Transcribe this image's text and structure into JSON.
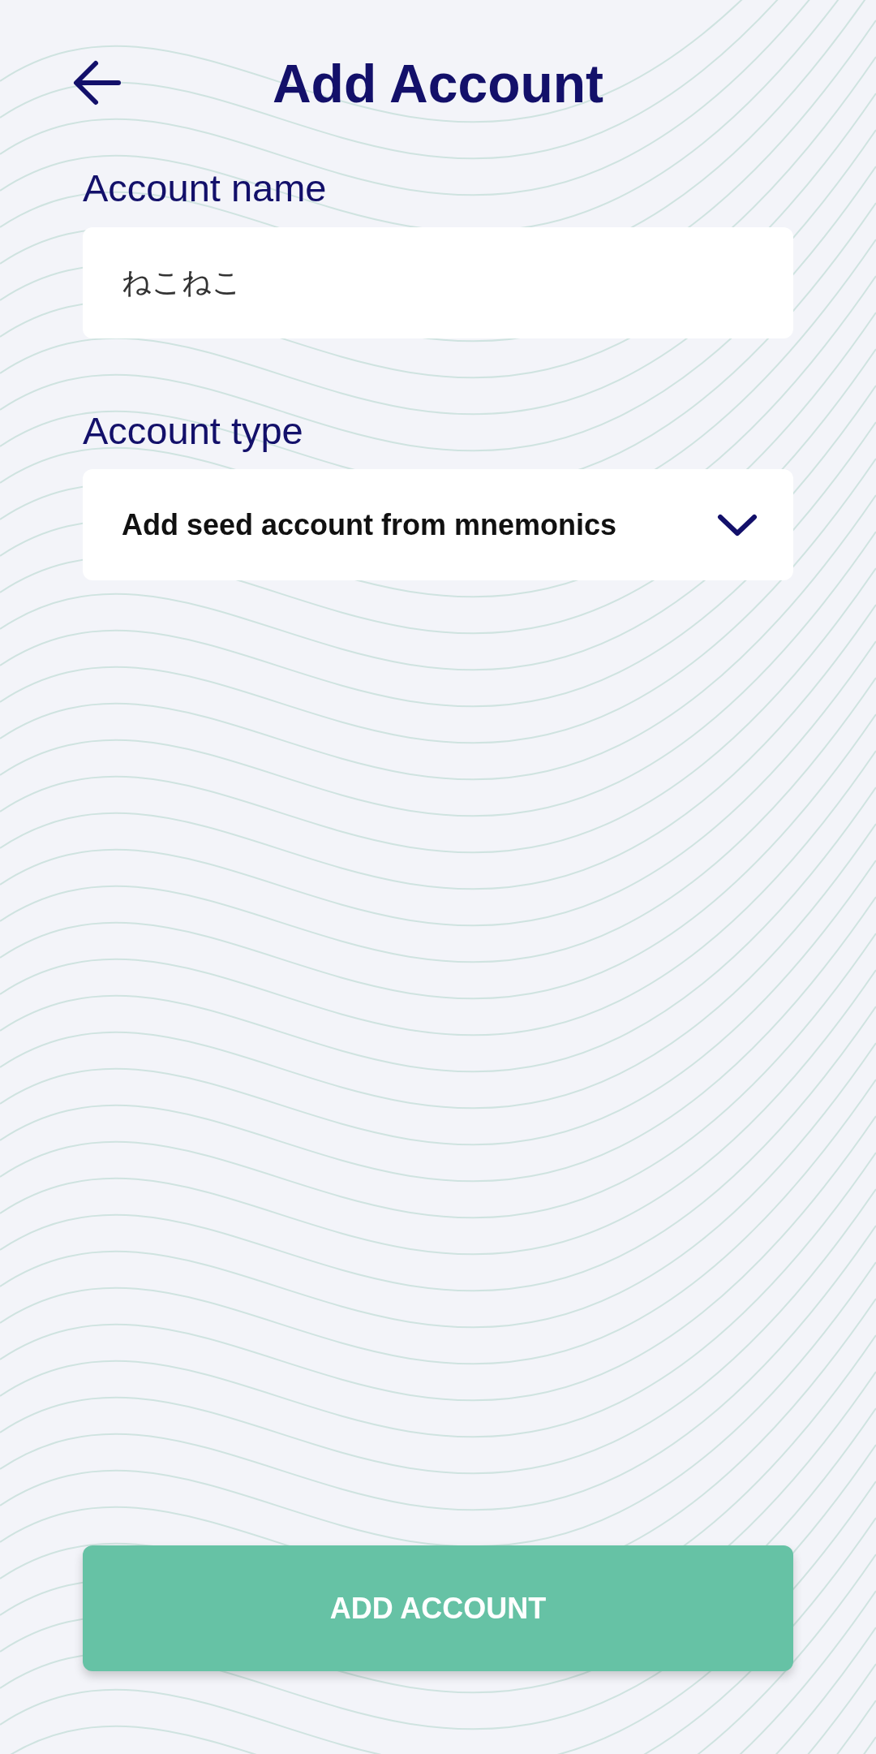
{
  "title": "Add Account",
  "fields": [
    {
      "kind": "text",
      "label": "Account name",
      "value": "ねこねこ"
    },
    {
      "kind": "select",
      "label": "Account type",
      "value": "Add seed account from mnemonics"
    }
  ],
  "button": "ADD ACCOUNT"
}
